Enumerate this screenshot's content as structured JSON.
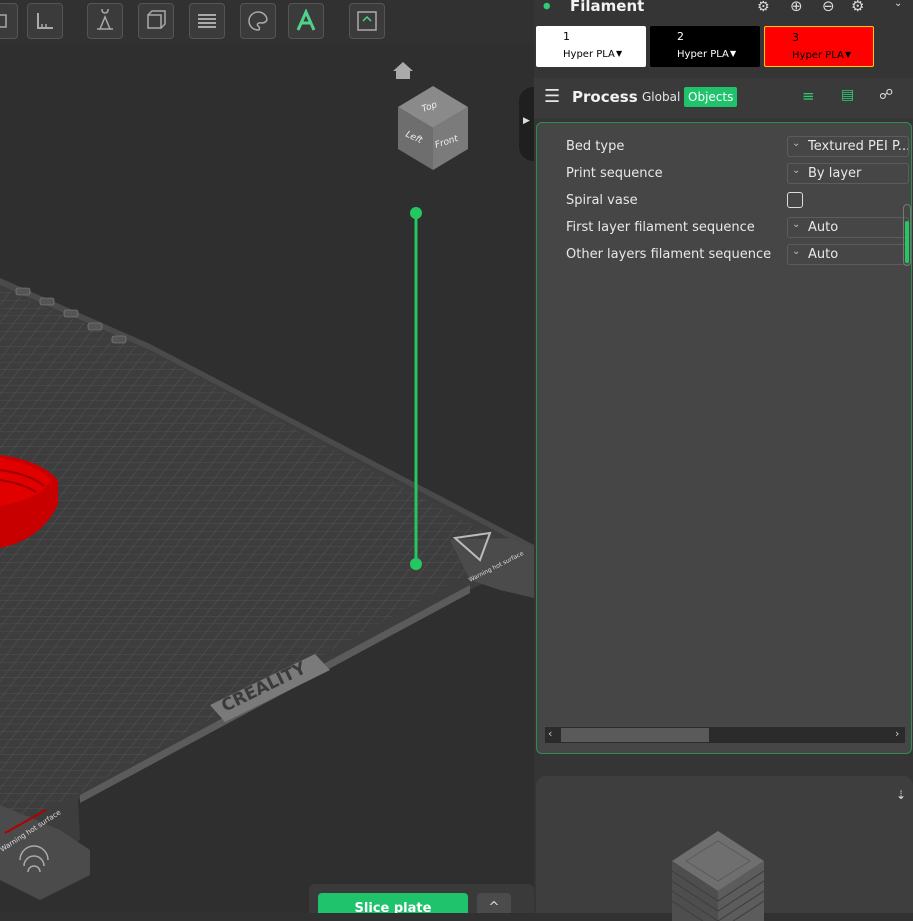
{
  "toolbar": {
    "tools": [
      "cube-icon",
      "ruler-icon",
      "support-paint-icon",
      "cut-icon",
      "layers-icon",
      "color-paint-icon",
      "text-icon",
      "assembly-icon"
    ]
  },
  "viewport": {
    "nav_cube": {
      "top": "Top",
      "left": "Left",
      "front": "Front"
    },
    "bed_brand": "CREALITY",
    "bed_warning_left": "Warning hot surface",
    "bed_warning_right": "Warning hot surface"
  },
  "filament": {
    "title": "Filament",
    "slots": [
      {
        "number": "1",
        "name": "Hyper PLA",
        "bg": "#ffffff",
        "fg": "#000000"
      },
      {
        "number": "2",
        "name": "Hyper PLA",
        "bg": "#000000",
        "fg": "#ffffff"
      },
      {
        "number": "3",
        "name": "Hyper PLA",
        "bg": "#ff0000",
        "fg": "#000000"
      }
    ]
  },
  "process": {
    "title": "Process",
    "tab_global": "Global",
    "tab_objects": "Objects"
  },
  "settings": {
    "bed_type": {
      "label": "Bed type",
      "value": "Textured PEI P..."
    },
    "print_sequence": {
      "label": "Print sequence",
      "value": "By layer"
    },
    "spiral_vase": {
      "label": "Spiral vase",
      "checked": false
    },
    "first_layer_seq": {
      "label": "First layer filament sequence",
      "value": "Auto"
    },
    "other_layers_seq": {
      "label": "Other layers filament sequence",
      "value": "Auto"
    }
  },
  "actions": {
    "slice": "Slice plate",
    "expand": "^"
  },
  "colors": {
    "accent": "#1ec36c",
    "frame": "#2c8f4f",
    "object": "#d40000"
  }
}
